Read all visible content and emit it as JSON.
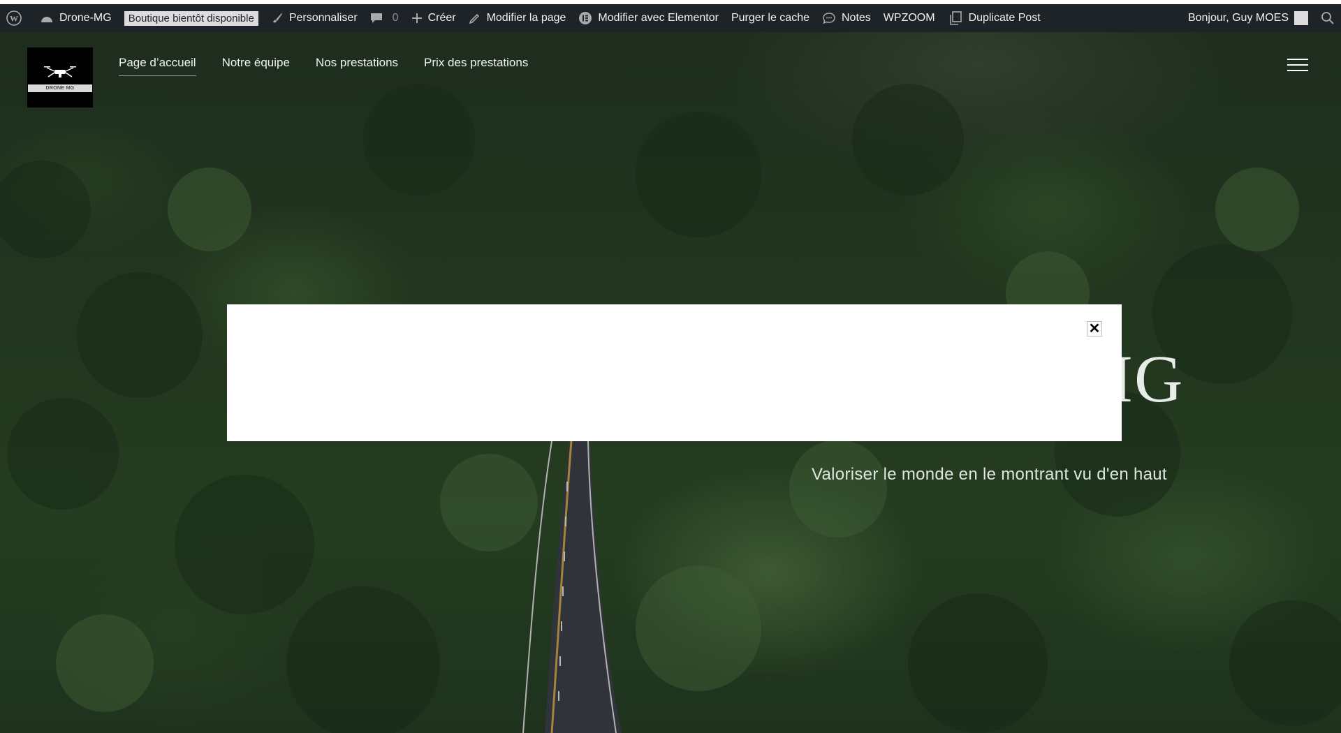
{
  "admin_bar": {
    "site_name": "Drone-MG",
    "boutique_badge": "Boutique bientôt disponible",
    "customize": "Personnaliser",
    "comments_count": "0",
    "create": "Créer",
    "edit_page": "Modifier la page",
    "edit_elementor": "Modifier avec Elementor",
    "purge_cache": "Purger le cache",
    "notes": "Notes",
    "wpzoom": "WPZOOM",
    "duplicate_post": "Duplicate Post",
    "greeting": "Bonjour, Guy MOES"
  },
  "header": {
    "logo_text": "DRONE MG",
    "nav": [
      {
        "label": "Page d’accueil",
        "active": true
      },
      {
        "label": "Notre équipe",
        "active": false
      },
      {
        "label": "Nos prestations",
        "active": false
      },
      {
        "label": "Prix des prestations",
        "active": false
      }
    ]
  },
  "hero": {
    "title_fragment": "IG",
    "subtitle": "Valoriser le monde en le montrant vu d'en haut"
  },
  "modal": {
    "close_symbol": "✕"
  },
  "icons": {
    "wordpress": "wordpress-icon",
    "dashboard": "dashboard-icon",
    "brush": "brush-icon",
    "comment": "comment-icon",
    "plus": "plus-icon",
    "pencil": "pencil-icon",
    "elementor": "elementor-icon",
    "notes": "speech-bubble-icon",
    "duplicate": "duplicate-icon",
    "search": "search-icon",
    "menu": "hamburger-icon"
  }
}
